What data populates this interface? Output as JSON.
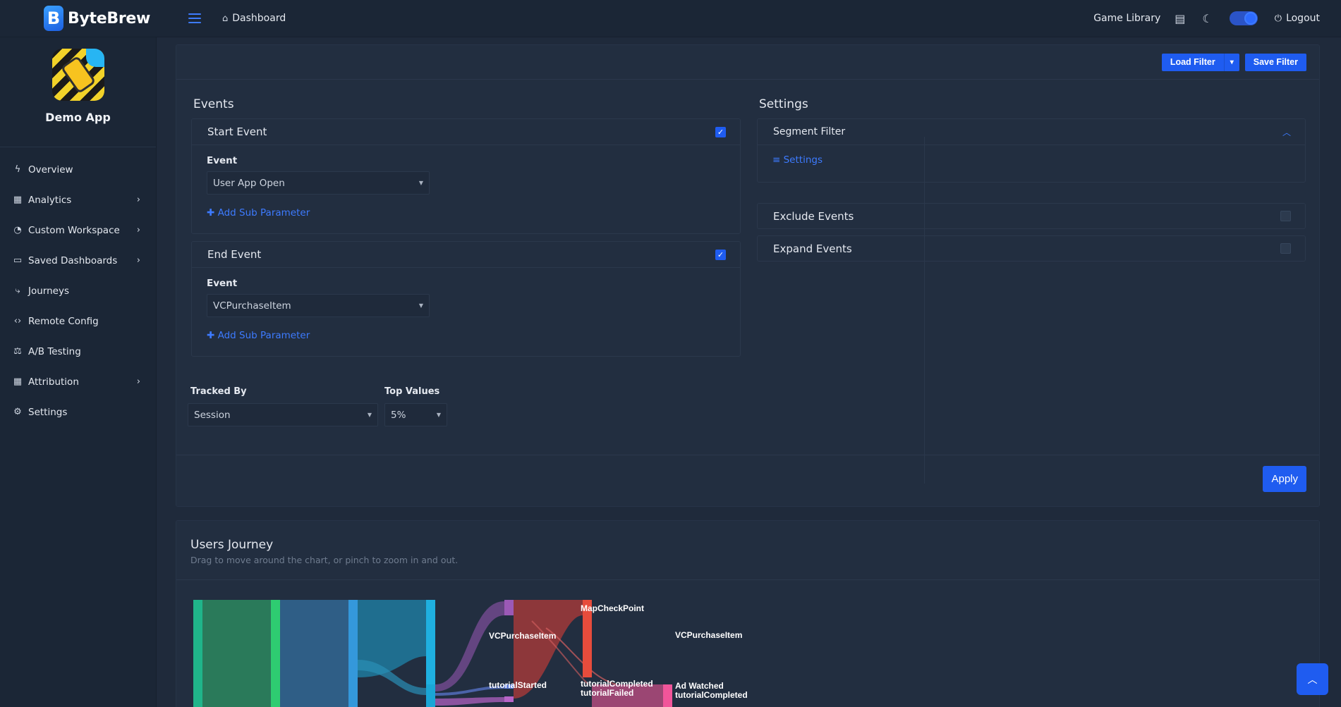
{
  "topbar": {
    "brand": "ByteBrew",
    "brand_letter": "B",
    "breadcrumb": "Dashboard",
    "game_library": "Game Library",
    "logout": "Logout"
  },
  "sidebar": {
    "app_name": "Demo App",
    "items": [
      {
        "label": "Overview",
        "icon": "bolt-icon",
        "glyph": "ϟ",
        "has_children": false
      },
      {
        "label": "Analytics",
        "icon": "grid-icon",
        "glyph": "▦",
        "has_children": true
      },
      {
        "label": "Custom Workspace",
        "icon": "pie-icon",
        "glyph": "◔",
        "has_children": true
      },
      {
        "label": "Saved Dashboards",
        "icon": "folder-icon",
        "glyph": "▭",
        "has_children": true
      },
      {
        "label": "Journeys",
        "icon": "route-icon",
        "glyph": "⤷",
        "has_children": false
      },
      {
        "label": "Remote Config",
        "icon": "code-icon",
        "glyph": "‹›",
        "has_children": false
      },
      {
        "label": "A/B Testing",
        "icon": "scale-icon",
        "glyph": "⚖",
        "has_children": false
      },
      {
        "label": "Attribution",
        "icon": "grid-icon",
        "glyph": "▦",
        "has_children": true
      },
      {
        "label": "Settings",
        "icon": "gear-icon",
        "glyph": "⚙",
        "has_children": false
      }
    ]
  },
  "filter": {
    "load_filter": "Load Filter",
    "save_filter": "Save Filter",
    "events_title": "Events",
    "settings_title": "Settings",
    "start_event": {
      "title": "Start Event",
      "checked": true,
      "label": "Event",
      "value": "User App Open",
      "add_sub": "Add Sub Parameter"
    },
    "end_event": {
      "title": "End Event",
      "checked": true,
      "label": "Event",
      "value": "VCPurchaseItem",
      "add_sub": "Add Sub Parameter"
    },
    "tracked_by": {
      "label": "Tracked By",
      "value": "Session"
    },
    "top_values": {
      "label": "Top Values",
      "value": "5%"
    },
    "segment_filter": {
      "title": "Segment Filter",
      "link": "Settings"
    },
    "exclude_events": {
      "title": "Exclude Events",
      "checked": false
    },
    "expand_events": {
      "title": "Expand Events",
      "checked": false
    },
    "apply": "Apply"
  },
  "journey": {
    "title": "Users Journey",
    "subtitle": "Drag to move around the chart, or pinch to zoom in and out.",
    "nodes": [
      "VCPurchaseItem",
      "tutorialStarted",
      "MapCheckPoint",
      "tutorialCompleted",
      "tutorialFailed",
      "VCPurchaseItem",
      "Ad Watched",
      "tutorialCompleted"
    ]
  }
}
